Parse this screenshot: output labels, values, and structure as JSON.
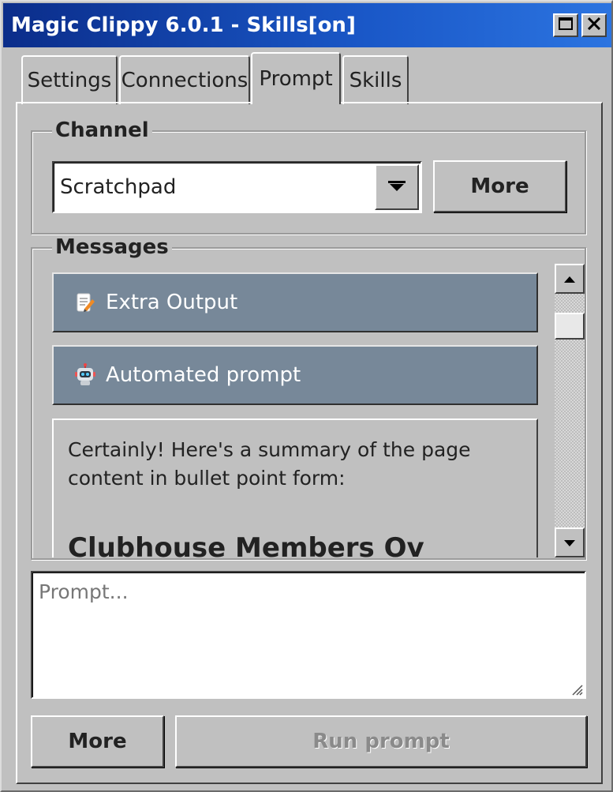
{
  "window": {
    "title": "Magic Clippy 6.0.1 - Skills[on]",
    "titlebar_color": "#1a58c8"
  },
  "titlebar_buttons": {
    "maximize_icon": "maximize-icon",
    "close_icon": "close-icon"
  },
  "tabs": [
    {
      "label": "Settings",
      "active": false
    },
    {
      "label": "Connections",
      "active": false
    },
    {
      "label": "Prompt",
      "active": true
    },
    {
      "label": "Skills",
      "active": false
    }
  ],
  "channel": {
    "legend": "Channel",
    "selected": "Scratchpad",
    "more_label": "More"
  },
  "messages": {
    "legend": "Messages",
    "items": [
      {
        "label": "Extra Output",
        "icon": "memo-pencil-icon"
      },
      {
        "label": "Automated prompt",
        "icon": "robot-icon"
      }
    ],
    "reply_text": "Certainly! Here's a summary of the page content in bullet point form:",
    "reply_heading": "Clubhouse Members Ov",
    "message_bg": "#778899"
  },
  "prompt": {
    "placeholder": "Prompt...",
    "value": ""
  },
  "footer": {
    "more_label": "More",
    "run_label": "Run prompt"
  }
}
